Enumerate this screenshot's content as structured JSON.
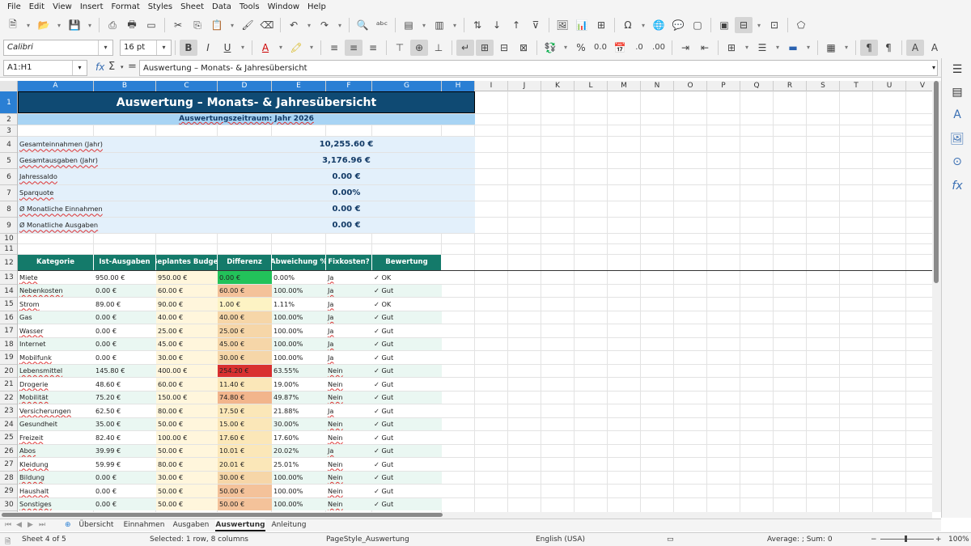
{
  "menu": [
    "File",
    "Edit",
    "View",
    "Insert",
    "Format",
    "Styles",
    "Sheet",
    "Data",
    "Tools",
    "Window",
    "Help"
  ],
  "toolbar": {
    "font_name": "Calibri",
    "font_size": "16 pt"
  },
  "formula_bar": {
    "name_box": "A1:H1",
    "content": "Auswertung – Monats- & Jahresübersicht"
  },
  "columns": [
    "A",
    "B",
    "C",
    "D",
    "E",
    "F",
    "G",
    "H",
    "I",
    "J",
    "K",
    "L",
    "M",
    "N",
    "O",
    "P",
    "Q",
    "R",
    "S",
    "T",
    "U",
    "V"
  ],
  "rows": [
    "1",
    "2",
    "3",
    "4",
    "5",
    "6",
    "7",
    "8",
    "9",
    "10",
    "11",
    "12",
    "13",
    "14",
    "15",
    "16",
    "17",
    "18",
    "19",
    "20",
    "21",
    "22",
    "23",
    "24",
    "25",
    "26",
    "27",
    "28",
    "29",
    "30"
  ],
  "sheet": {
    "title": "Auswertung – Monats- & Jahresübersicht",
    "subtitle": "Auswertungszeitraum: Jahr 2026",
    "summary": [
      {
        "label": "Gesamteinnahmen (Jahr)",
        "value": "10,255.60 €"
      },
      {
        "label": "Gesamtausgaben (Jahr)",
        "value": "3,176.96 €"
      },
      {
        "label": "Jahressaldo",
        "value": "0.00 €"
      },
      {
        "label": "Sparquote",
        "value": "0.00%"
      },
      {
        "label": "Ø Monatliche Einnahmen",
        "value": "0.00 €"
      },
      {
        "label": "Ø Monatliche Ausgaben",
        "value": "0.00 €"
      }
    ],
    "table_headers": [
      "Kategorie",
      "Ist-Ausgaben",
      "Geplantes Budget",
      "Differenz",
      "Abweichung %",
      "Fixkosten?",
      "Bewertung"
    ],
    "table_rows": [
      [
        "Miete",
        "950.00 €",
        "950.00 €",
        "0.00 €",
        "0.00%",
        "Ja",
        "✓ OK"
      ],
      [
        "Nebenkosten",
        "0.00 €",
        "60.00 €",
        "60.00 €",
        "100.00%",
        "Ja",
        "✓ Gut"
      ],
      [
        "Strom",
        "89.00 €",
        "90.00 €",
        "1.00 €",
        "1.11%",
        "Ja",
        "✓ OK"
      ],
      [
        "Gas",
        "0.00 €",
        "40.00 €",
        "40.00 €",
        "100.00%",
        "Ja",
        "✓ Gut"
      ],
      [
        "Wasser",
        "0.00 €",
        "25.00 €",
        "25.00 €",
        "100.00%",
        "Ja",
        "✓ Gut"
      ],
      [
        "Internet",
        "0.00 €",
        "45.00 €",
        "45.00 €",
        "100.00%",
        "Ja",
        "✓ Gut"
      ],
      [
        "Mobilfunk",
        "0.00 €",
        "30.00 €",
        "30.00 €",
        "100.00%",
        "Ja",
        "✓ Gut"
      ],
      [
        "Lebensmittel",
        "145.80 €",
        "400.00 €",
        "254.20 €",
        "63.55%",
        "Nein",
        "✓ Gut"
      ],
      [
        "Drogerie",
        "48.60 €",
        "60.00 €",
        "11.40 €",
        "19.00%",
        "Nein",
        "✓ Gut"
      ],
      [
        "Mobilität",
        "75.20 €",
        "150.00 €",
        "74.80 €",
        "49.87%",
        "Nein",
        "✓ Gut"
      ],
      [
        "Versicherungen",
        "62.50 €",
        "80.00 €",
        "17.50 €",
        "21.88%",
        "Ja",
        "✓ Gut"
      ],
      [
        "Gesundheit",
        "35.00 €",
        "50.00 €",
        "15.00 €",
        "30.00%",
        "Nein",
        "✓ Gut"
      ],
      [
        "Freizeit",
        "82.40 €",
        "100.00 €",
        "17.60 €",
        "17.60%",
        "Nein",
        "✓ Gut"
      ],
      [
        "Abos",
        "39.99 €",
        "50.00 €",
        "10.01 €",
        "20.02%",
        "Ja",
        "✓ Gut"
      ],
      [
        "Kleidung",
        "59.99 €",
        "80.00 €",
        "20.01 €",
        "25.01%",
        "Nein",
        "✓ Gut"
      ],
      [
        "Bildung",
        "0.00 €",
        "30.00 €",
        "30.00 €",
        "100.00%",
        "Nein",
        "✓ Gut"
      ],
      [
        "Haushalt",
        "0.00 €",
        "50.00 €",
        "50.00 €",
        "100.00%",
        "Nein",
        "✓ Gut"
      ],
      [
        "Sonstiges",
        "0.00 €",
        "50.00 €",
        "50.00 €",
        "100.00%",
        "Nein",
        "✓ Gut"
      ]
    ],
    "diff_colors": [
      "#22c25a",
      "#f4c29a",
      "#fdf3c4",
      "#f6d6a8",
      "#f6d6a8",
      "#f6d6a8",
      "#f6d6a8",
      "#d93030",
      "#fbe7b8",
      "#f2b58c",
      "#fbe7b8",
      "#fbe7b8",
      "#fbe7b8",
      "#fbe7b8",
      "#fbe7b8",
      "#f6d6a8",
      "#f4c29a",
      "#f4c29a"
    ]
  },
  "tabs": [
    "Übersicht",
    "Einnahmen",
    "Ausgaben",
    "Auswertung",
    "Anleitung"
  ],
  "active_tab": "Auswertung",
  "status": {
    "sheet": "Sheet 4 of 5",
    "selection": "Selected: 1 row, 8 columns",
    "page_style": "PageStyle_Auswertung",
    "language": "English (USA)",
    "stats": "Average: ; Sum: 0",
    "zoom": "100%"
  },
  "colors": {
    "accent": "#2a7fd4",
    "title_bg": "#0f4a73",
    "table_header": "#147a6a",
    "summary_bg": "#e3f0fb"
  }
}
